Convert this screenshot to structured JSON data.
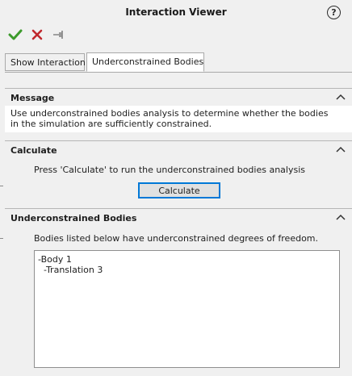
{
  "window": {
    "title": "Interaction Viewer",
    "help_icon": "question-circle-icon",
    "help_symbol": "?"
  },
  "toolbar": {
    "ok_icon": "checkmark-icon",
    "cancel_icon": "x-icon",
    "pin_icon": "pushpin-icon"
  },
  "tabs": [
    {
      "label": "Show Interaction",
      "active": false
    },
    {
      "label": "Underconstrained Bodies",
      "active": true
    }
  ],
  "sections": {
    "message": {
      "title": "Message",
      "text": "Use underconstrained bodies analysis to determine whether the bodies in the simulation are sufficiently constrained."
    },
    "calculate": {
      "title": "Calculate",
      "prompt": "Press 'Calculate' to run the underconstrained bodies analysis",
      "button_label": "Calculate"
    },
    "underconstrained": {
      "title": "Underconstrained Bodies",
      "description": "Bodies listed below have underconstrained degrees of freedom.",
      "results": [
        "-Body 1",
        "  -Translation 3"
      ]
    }
  },
  "colors": {
    "accent_blue": "#0078d7",
    "ok_green": "#3c9a2b",
    "cancel_red": "#c0282d",
    "panel_bg": "#f0f0f0"
  }
}
